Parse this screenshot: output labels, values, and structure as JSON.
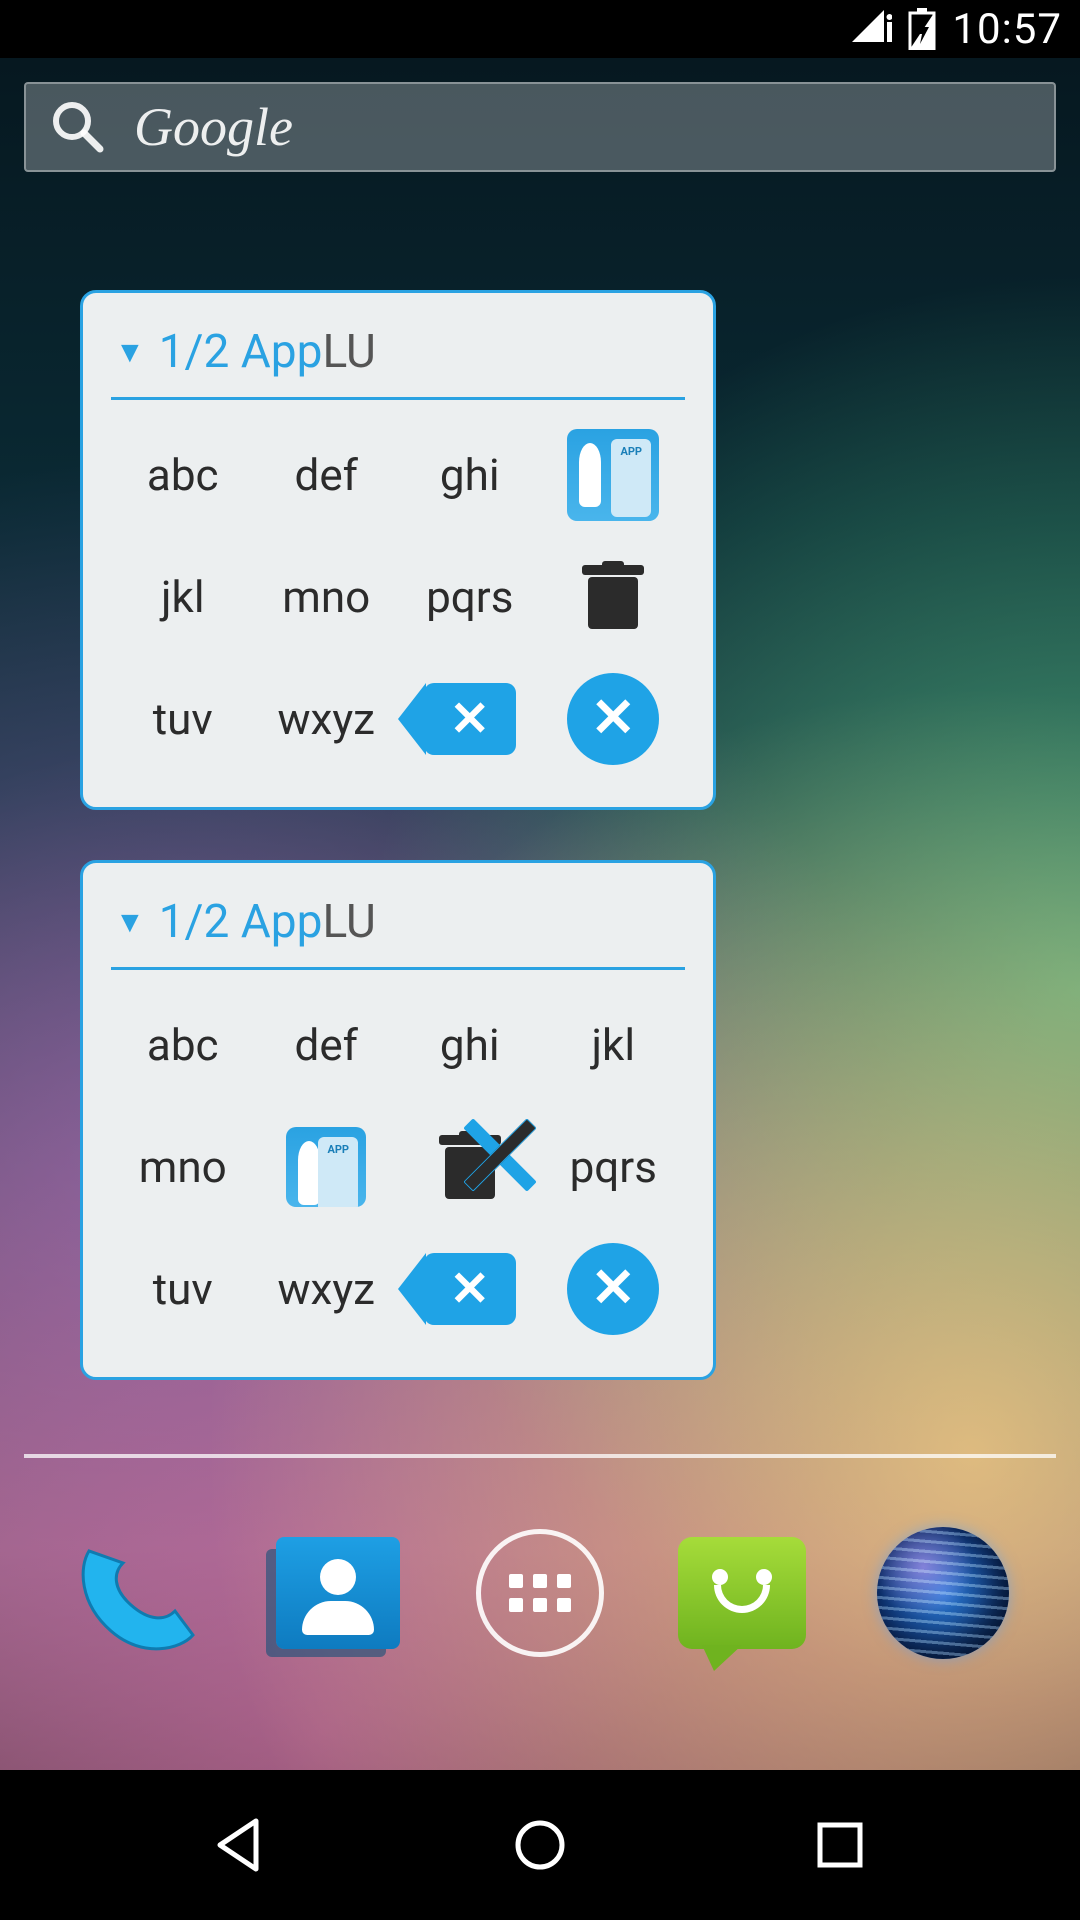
{
  "status_bar": {
    "time": "10:57"
  },
  "search": {
    "placeholder": "Google"
  },
  "widget1": {
    "title_prefix": "1/2 App",
    "title_suffix": "LU",
    "keys": {
      "r0c0": "abc",
      "r0c1": "def",
      "r0c2": "ghi",
      "r1c0": "jkl",
      "r1c1": "mno",
      "r1c2": "pqrs",
      "r2c0": "tuv",
      "r2c1": "wxyz"
    }
  },
  "widget2": {
    "title_prefix": "1/2 App",
    "title_suffix": "LU",
    "keys": {
      "r0c0": "abc",
      "r0c1": "def",
      "r0c2": "ghi",
      "r0c3": "jkl",
      "r1c0": "mno",
      "r1c3": "pqrs",
      "r2c0": "tuv",
      "r2c1": "wxyz"
    }
  },
  "dock": {
    "items": [
      "phone",
      "contacts",
      "apps",
      "messaging",
      "browser"
    ]
  },
  "nav": {
    "items": [
      "back",
      "home",
      "recents"
    ]
  }
}
